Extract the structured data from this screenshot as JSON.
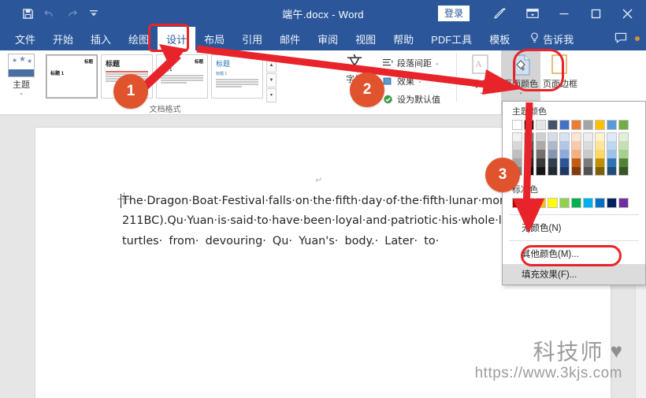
{
  "window": {
    "title": "端午.docx  -  Word",
    "signin_label": "登录",
    "quick_access": [
      {
        "name": "save",
        "glyph": "save-icon"
      },
      {
        "name": "undo",
        "glyph": "undo-icon"
      },
      {
        "name": "redo",
        "glyph": "redo-icon"
      },
      {
        "name": "customize-qat",
        "glyph": "chevron-down-icon"
      }
    ],
    "controls": [
      {
        "name": "ink-tools",
        "glyph": "pen-icon"
      },
      {
        "name": "ribbon-display-options",
        "glyph": "ribbon-options-icon"
      },
      {
        "name": "minimize",
        "glyph": "minimize-icon"
      },
      {
        "name": "maximize",
        "glyph": "maximize-icon"
      },
      {
        "name": "close",
        "glyph": "close-icon"
      }
    ]
  },
  "tabs": [
    {
      "label": "文件",
      "active": false
    },
    {
      "label": "开始",
      "active": false
    },
    {
      "label": "插入",
      "active": false
    },
    {
      "label": "绘图",
      "active": false
    },
    {
      "label": "设计",
      "active": true
    },
    {
      "label": "布局",
      "active": false
    },
    {
      "label": "引用",
      "active": false
    },
    {
      "label": "邮件",
      "active": false
    },
    {
      "label": "审阅",
      "active": false
    },
    {
      "label": "视图",
      "active": false
    },
    {
      "label": "帮助",
      "active": false
    },
    {
      "label": "PDF工具",
      "active": false
    },
    {
      "label": "模板",
      "active": false
    }
  ],
  "tell_me": {
    "label": "告诉我",
    "icon": "lightbulb-icon"
  },
  "ribbon": {
    "group_name": "文档格式",
    "themes": {
      "label": "主题",
      "caret": "⌄"
    },
    "gallery": {
      "thumbs": [
        {
          "title": "标题",
          "heading": "标题 1",
          "variant": "selected"
        },
        {
          "title": "标题",
          "heading": "标题 1",
          "variant": "plain-big"
        },
        {
          "title": "标题",
          "heading": "标题 1",
          "variant": "plain"
        },
        {
          "title": "标题",
          "heading": "标题 1",
          "variant": "blue"
        }
      ],
      "nav_up": "▲",
      "nav_down": "▼",
      "nav_more": "▾"
    },
    "fonts": {
      "label": "字体",
      "glyph": "文",
      "caret": "⌄"
    },
    "commands": [
      {
        "label": "段落间距",
        "icon": "paragraph-spacing-icon",
        "caret": "⌄"
      },
      {
        "label": "效果",
        "icon": "effects-icon",
        "caret": "⌄"
      },
      {
        "label": "设为默认值",
        "icon": "set-default-icon",
        "caret": ""
      }
    ],
    "page_background": [
      {
        "label": "水印",
        "icon": "watermark-icon",
        "caret": "⌄",
        "active": false
      },
      {
        "label": "页面颜色",
        "icon": "page-color-icon",
        "caret": "⌄",
        "active": true
      },
      {
        "label": "页面边框",
        "icon": "page-border-icon",
        "caret": "",
        "active": false
      }
    ]
  },
  "dropdown": {
    "theme_colors_label": "主题颜色",
    "standard_colors_label": "标准色",
    "theme_base": [
      "#ffffff",
      "#000000",
      "#e7e6e6",
      "#44546a",
      "#4472c4",
      "#ed7d31",
      "#a5a5a5",
      "#ffc000",
      "#5b9bd5",
      "#70ad47"
    ],
    "theme_tints": [
      [
        "#f2f2f2",
        "#7f7f7f",
        "#d0cece",
        "#d6dce4",
        "#d9e2f3",
        "#fbe5d5",
        "#ededed",
        "#fff2cc",
        "#deeaf6",
        "#e2efd9"
      ],
      [
        "#d8d8d8",
        "#595959",
        "#aeaaaa",
        "#adb9ca",
        "#b4c6e7",
        "#f7caac",
        "#dbdbdb",
        "#ffe599",
        "#bdd7ee",
        "#c5e0b3"
      ],
      [
        "#bfbfbf",
        "#3f3f3f",
        "#757070",
        "#8496b0",
        "#8eaadb",
        "#f4b083",
        "#c9c9c9",
        "#ffd965",
        "#9cc3e5",
        "#a8d08d"
      ],
      [
        "#a5a5a5",
        "#262626",
        "#3a3838",
        "#333f4f",
        "#2f5496",
        "#c55a11",
        "#7b7b7b",
        "#bf9000",
        "#2e75b5",
        "#538135"
      ],
      [
        "#7f7f7f",
        "#0c0c0c",
        "#171616",
        "#222a35",
        "#1f3864",
        "#833c0b",
        "#525252",
        "#7f6000",
        "#1e4e79",
        "#375623"
      ]
    ],
    "standard_colors": [
      "#c00000",
      "#ff0000",
      "#ffc000",
      "#ffff00",
      "#92d050",
      "#00b050",
      "#00b0f0",
      "#0070c0",
      "#002060",
      "#7030a0"
    ],
    "items": [
      {
        "label": "无颜色(N)",
        "highlight": false
      },
      {
        "label": "其他颜色(M)...",
        "highlight": false
      },
      {
        "label": "填充效果(F)...",
        "highlight": true
      }
    ]
  },
  "document": {
    "pilcrow": "↵",
    "body": "The·Dragon·Boat·Festival·falls·on·the·fifth·day·of·the·fifth·lunar·month.·There·are·many·different·legends·about·the·festival,·but·the·most·famous·one·is·about·Qu·Yuan·a·patriotic·poet·of·the·State·of·Chu·during·the·Warring·States·Period(475-211BC).Qu·Yuan·is·said·to·have·been·loyal·and·patriotic·his·whole·life.·When·he·realized·the·decline·of·Chu·was·beyond·recovery,·his·remorse·knowing·he·could·no·longer·save·it·grew·stronger·and·stronger.·On·the·fifth·day·of·the·fifth·lunar·month,·he·threw·himself·into·the·river·and·died·for·his·beloved·homeland.·Locals·living·adjacent·to·the·river·rushed·into·their·boats·to·search·for·him.·They·threw·jiaosu·(rice·dumplings)·and·other·food·into·the·river·to·keep·fish·and·  turtles·  from·  devouring·  Qu·  Yuan's·  body.·  Later·  to·"
  },
  "watermark": {
    "brand": "科技师",
    "heart": "♥",
    "url": "https://www.3kjs.com"
  },
  "annotations": {
    "badges": [
      {
        "label": "1"
      },
      {
        "label": "2"
      },
      {
        "label": "3"
      }
    ],
    "accent_color": "#e8242a",
    "badge_color": "#e0532c"
  }
}
